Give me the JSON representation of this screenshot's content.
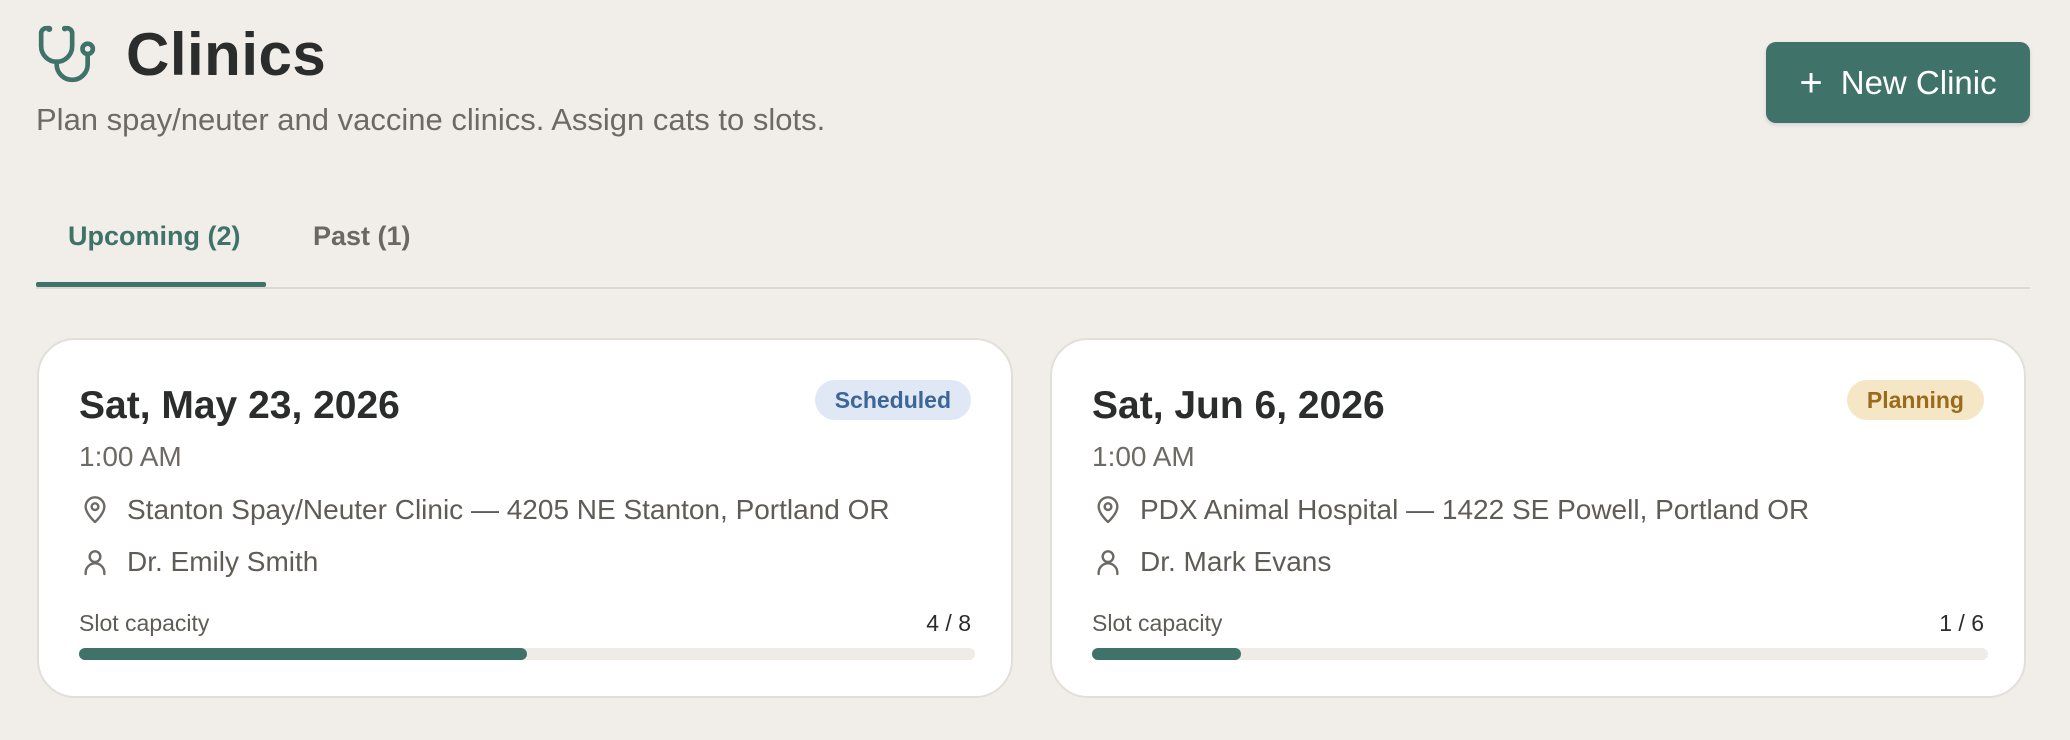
{
  "header": {
    "title": "Clinics",
    "subtitle": "Plan spay/neuter and vaccine clinics. Assign cats to slots.",
    "icon": "stethoscope-icon",
    "new_button_label": "New Clinic",
    "new_button_icon": "plus-icon"
  },
  "tabs": [
    {
      "label": "Upcoming (2)",
      "active": true
    },
    {
      "label": "Past (1)",
      "active": false
    }
  ],
  "clinics": [
    {
      "date": "Sat, May 23, 2026",
      "time": "1:00 AM",
      "status": "Scheduled",
      "location": "Stanton Spay/Neuter Clinic — 4205 NE Stanton, Portland OR",
      "vet": "Dr. Emily Smith",
      "capacity_label": "Slot capacity",
      "capacity_text": "4 / 8",
      "capacity_fraction": 0.5
    },
    {
      "date": "Sat, Jun 6, 2026",
      "time": "1:00 AM",
      "status": "Planning",
      "location": "PDX Animal Hospital — 1422 SE Powell, Portland OR",
      "vet": "Dr. Mark Evans",
      "capacity_label": "Slot capacity",
      "capacity_text": "1 / 6",
      "capacity_fraction": 0.1667
    }
  ],
  "colors": {
    "accent": "#3f7268",
    "background": "#f1eee9",
    "scheduled_badge_bg": "#dfe8f4",
    "scheduled_badge_text": "#3e6597",
    "planning_badge_bg": "#f5e7c6",
    "planning_badge_text": "#9a6b1c"
  }
}
